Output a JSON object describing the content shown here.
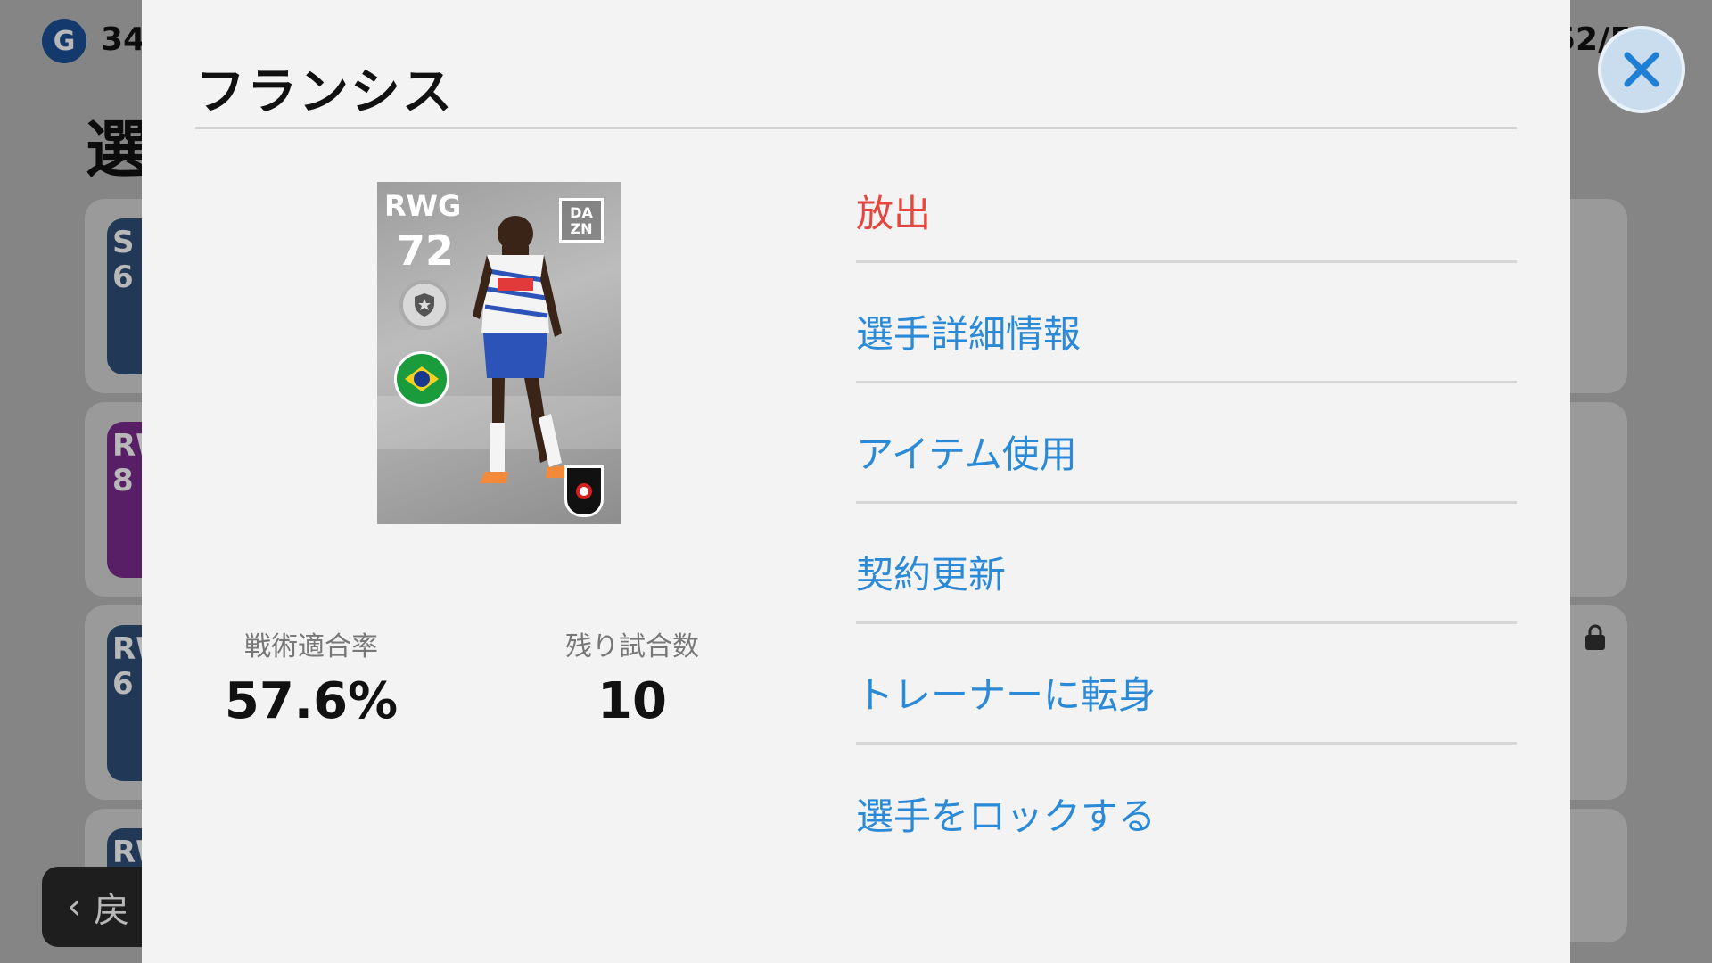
{
  "background": {
    "currency_icon": "G",
    "currency_amount": "34",
    "roster_count": "52/5",
    "heading": "選",
    "back_label": "戻",
    "mini_cards": [
      {
        "pos": "S",
        "rating": "6"
      },
      {
        "pos": "RW",
        "rating": "8"
      },
      {
        "pos": "RW",
        "rating": "6"
      },
      {
        "pos": "RW",
        "rating": ""
      }
    ],
    "lock_icon": "lock-icon"
  },
  "modal": {
    "title": "フランシス",
    "card": {
      "position": "RWG",
      "rating": "72",
      "broadcaster_line1": "DA",
      "broadcaster_line2": "ZN",
      "flag": "brazil-flag-icon",
      "league_logo": "j-league-logo"
    },
    "stats": [
      {
        "label": "戦術適合率",
        "value": "57.6%"
      },
      {
        "label": "残り試合数",
        "value": "10"
      }
    ],
    "menu": [
      {
        "label": "放出",
        "type": "danger"
      },
      {
        "label": "選手詳細情報",
        "type": "normal"
      },
      {
        "label": "アイテム使用",
        "type": "normal"
      },
      {
        "label": "契約更新",
        "type": "normal"
      },
      {
        "label": "トレーナーに転身",
        "type": "normal"
      },
      {
        "label": "選手をロックする",
        "type": "normal"
      }
    ],
    "close_icon": "close-icon"
  },
  "colors": {
    "menu_link": "#2a8ad8",
    "menu_danger": "#e5463d",
    "close_button": "#c9ddee",
    "close_x": "#1f7fd4"
  }
}
